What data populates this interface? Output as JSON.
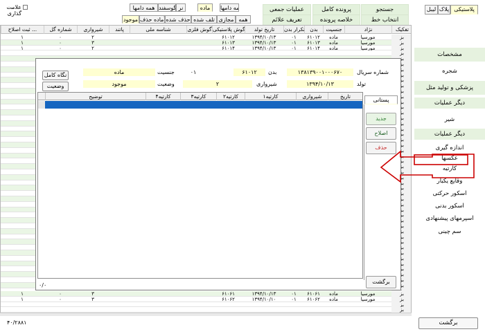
{
  "header": {
    "checkbox_label": "علامت\nگذاری",
    "animal_tabs": [
      "پلاستیکی",
      "پلاک",
      "لیبل"
    ],
    "row1_tabs": [
      "همه دامها",
      "ماده",
      "نر",
      "گوسفند",
      "همه دامها"
    ],
    "row2_tabs": [
      "همه",
      "مجازی",
      "تلف شده",
      "حذف شده",
      "آماده حذف",
      "موجود"
    ],
    "buttons": {
      "search": "جستجو",
      "full_file": "پرونده کامل",
      "batch_ops": "عملیات جمعی",
      "select_line": "انتخاب خط",
      "file_summary": "خلاصه پرونده",
      "define_signs": "تعریف علائم"
    }
  },
  "grid": {
    "columns": [
      "تفکیک",
      "نژاد",
      "جنسیت",
      "بدن",
      "تکرار بدن",
      "تاریخ تولد",
      "گوش پلاستیکی",
      "گوش فلزی",
      "شناسه ملی",
      "پاتند",
      "شیرواری",
      "شماره گل",
      "ثبت اصلاح ..."
    ],
    "rows_top": [
      [
        "بز",
        "مورسیا",
        "ماده",
        "۶۱۰۱۲",
        "۰۱",
        "۱۳۹۴/۱۰/۱۳",
        "۶۱۰۱۲",
        "",
        "",
        "",
        "۲",
        "۰",
        "۱"
      ],
      [
        "بز",
        "مورسیا",
        "ماده",
        "۶۱۰۱۳",
        "۰۱",
        "۱۳۹۴/۱۰/۱۳",
        "۶۱۰۱۳",
        "",
        "",
        "",
        "۳",
        "۰",
        "۱"
      ],
      [
        "بز",
        "مورسیا",
        "ماده",
        "۶۱۰۱۴",
        "۰۱",
        "۱۳۹۴/۱۰/۱۳",
        "۶۱۰۱۴",
        "",
        "",
        "",
        "۲",
        "۰",
        "۱"
      ]
    ],
    "rows_bottom": [
      [
        "بز",
        "مورسیا",
        "ماده",
        "۶۱۰۶۱",
        "۰۱",
        "۱۳۹۴/۱۰/۱۳",
        "۶۱۰۶۱",
        "",
        "",
        "",
        "۳",
        "۰",
        "۱"
      ],
      [
        "بز",
        "مورسیا",
        "ماده",
        "۶۱۰۶۲",
        "۰۱",
        "۱۳۹۴/۱۰/۱۰",
        "۶۱۰۶۲",
        "",
        "",
        "",
        "۳",
        "۰",
        "۱"
      ]
    ],
    "side_labels": [
      "بز",
      "بز",
      "بز",
      "بز",
      "بز",
      "بز",
      "بز",
      "بز",
      "بز",
      "بز",
      "بز",
      "بز",
      "بز",
      "بز",
      "بز",
      "بز",
      "بز",
      "بز",
      "بز",
      "بز",
      "بز",
      "بز",
      "بز",
      "بز",
      "بز",
      "بز",
      "بز",
      "بز",
      "بز",
      "بز",
      "بز",
      "بز",
      "بز",
      "بز",
      "بز",
      "بز",
      "بز",
      "بز",
      "بز",
      "بز",
      "بز",
      "بز",
      "بز",
      "بز"
    ],
    "footer_count": "۴۰/۲۸۸۱"
  },
  "dialog": {
    "serial_label": "شماره سریال",
    "serial_value": "۱۳۸۱۳۹۰۰۱۰۰۰۶۷۰",
    "body_label": "بدن",
    "body_num": "۶۱۰۱۲",
    "body_rep": "۰۱",
    "gender_label": "جنسیت",
    "gender_value": "ماده",
    "birth_label": "تولد",
    "birth_value": "۱۳۹۴/۱۰/۱۳",
    "milk_label": "شیرواری",
    "milk_value": "۲",
    "status_label": "وضعیت",
    "status_value": "موجود",
    "keep_full_btn": "نگاه کامل",
    "status_btn": "وضعیت",
    "tab_label": "پستانی",
    "table_columns": [
      "تاریخ",
      "شیرواری",
      "کارتیه۱",
      "کارتیه۲",
      "کارتیه۳",
      "کارتیه۴",
      "توضیح"
    ],
    "new_btn": "جدید",
    "edit_btn": "اصلاح",
    "delete_btn": "حذف",
    "back_btn": "برگشت",
    "footer_count": "۰/۰"
  },
  "right_panel": {
    "items": [
      "مشخصات",
      "شجره",
      "پزشکی و تولید مثل",
      "دیگر عملیات",
      "شیر",
      "دیگر عملیات",
      "اندازه گیری",
      "عکسها",
      "کارتیه",
      "وقایع یکبار",
      "اسکور حرکتی",
      "اسکور بدنی",
      "اسپرمهای پیشنهادی",
      "سم چینی"
    ],
    "back_btn": "برگشت"
  },
  "colors": {
    "selected_row": "#1565c0",
    "highlight_box": "#ffffd1",
    "annotation": "#cc0000",
    "green_bg": "#e6f2df"
  }
}
